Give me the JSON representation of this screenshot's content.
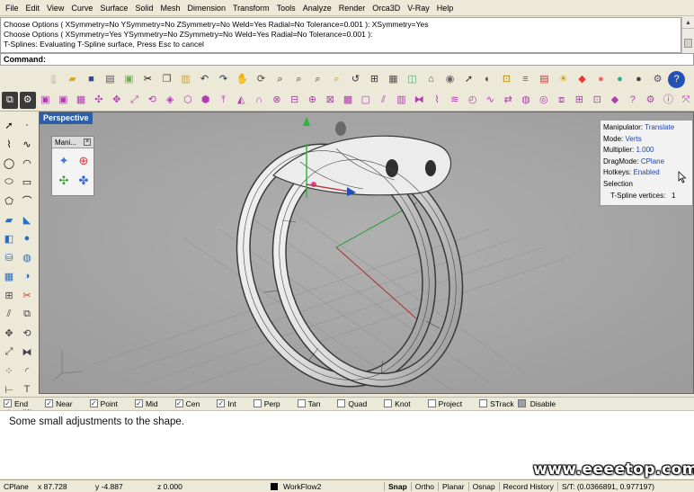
{
  "menu": [
    "File",
    "Edit",
    "View",
    "Curve",
    "Surface",
    "Solid",
    "Mesh",
    "Dimension",
    "Transform",
    "Tools",
    "Analyze",
    "Render",
    "Orca3D",
    "V-Ray",
    "Help"
  ],
  "command_history": [
    "Choose Options ( XSymmetry=No  YSymmetry=No  ZSymmetry=No  Weld=Yes  Radial=No  Tolerance=0.001 ): XSymmetry=Yes",
    "Choose Options ( XSymmetry=Yes  YSymmetry=No  ZSymmetry=No  Weld=Yes  Radial=No  Tolerance=0.001 ):",
    "T-Splines: Evaluating T-Spline surface, Press Esc to cancel"
  ],
  "command_label": "Command:",
  "viewport": {
    "title": "Perspective",
    "mani_panel_title": "Mani...",
    "info": {
      "manipulator_label": "Manipulator:",
      "manipulator_value": "Translate",
      "mode_label": "Mode:",
      "mode_value": "Verts",
      "multiplier_label": "Multiplier:",
      "multiplier_value": "1.000",
      "dragmode_label": "DragMode:",
      "dragmode_value": "CPlane",
      "hotkeys_label": "Hotkeys:",
      "hotkeys_value": "Enabled",
      "selection_label": "Selection",
      "tspline_label": "T-Spline vertices:",
      "tspline_value": "1"
    }
  },
  "osnaps": [
    {
      "label": "End",
      "checked": true
    },
    {
      "label": "Near",
      "checked": true
    },
    {
      "label": "Point",
      "checked": true
    },
    {
      "label": "Mid",
      "checked": true
    },
    {
      "label": "Cen",
      "checked": true
    },
    {
      "label": "Int",
      "checked": true
    },
    {
      "label": "Perp",
      "checked": false
    },
    {
      "label": "Tan",
      "checked": false
    },
    {
      "label": "Quad",
      "checked": false
    },
    {
      "label": "Knot",
      "checked": false
    },
    {
      "label": "Project",
      "checked": false
    },
    {
      "label": "STrack",
      "checked": false
    }
  ],
  "osnap_disable": "Disable",
  "comment": "Some small adjustments to the shape.",
  "status": {
    "cplane": "CPlane",
    "x": "x 87.728",
    "y": "y -4.887",
    "z": "z 0.000",
    "layer": "WorkFlow2",
    "snap": "Snap",
    "ortho": "Ortho",
    "planar": "Planar",
    "osnap": "Osnap",
    "record_history": "Record History",
    "st": "S/T: (0.0366891, 0.977197)"
  },
  "watermark": "www.eeeetop.com",
  "colors": {
    "viewport_bg": "#a3a3a3",
    "viewport_title_bg": "#2d5fa8",
    "info_value": "#1c46b5"
  }
}
